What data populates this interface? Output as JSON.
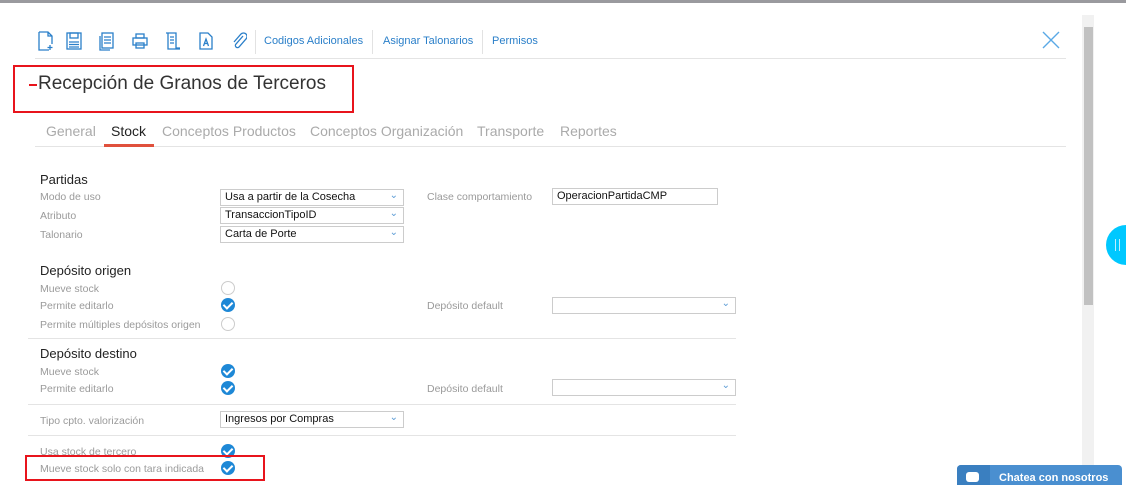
{
  "toolbar": {
    "icons": [
      "new-document-icon",
      "save-icon",
      "copy-icon",
      "print-icon",
      "list-document-icon",
      "text-document-icon",
      "attachment-icon"
    ],
    "links": [
      "Codigos Adicionales",
      "Asignar Talonarios",
      "Permisos"
    ]
  },
  "title": "Recepción de Granos de Terceros",
  "tabs": [
    "General",
    "Stock",
    "Conceptos Productos",
    "Conceptos Organización",
    "Transporte",
    "Reportes"
  ],
  "active_tab": "Stock",
  "partidas": {
    "heading": "Partidas",
    "modo_label": "Modo de uso",
    "modo_value": "Usa a partir de la Cosecha",
    "atributo_label": "Atributo",
    "atributo_value": "TransaccionTipoID",
    "talonario_label": "Talonario",
    "talonario_value": "Carta de Porte",
    "clase_label": "Clase comportamiento",
    "clase_value": "OperacionPartidaCMP"
  },
  "origen": {
    "heading": "Depósito origen",
    "mueve_label": "Mueve stock",
    "mueve": false,
    "editar_label": "Permite editarlo",
    "editar": true,
    "multiples_label": "Permite múltiples depósitos origen",
    "multiples": false,
    "default_label": "Depósito default",
    "default_value": ""
  },
  "destino": {
    "heading": "Depósito destino",
    "mueve_label": "Mueve stock",
    "mueve": true,
    "editar_label": "Permite editarlo",
    "editar": true,
    "default_label": "Depósito default",
    "default_value": ""
  },
  "valorizacion": {
    "label": "Tipo cpto. valorización",
    "value": "Ingresos por Compras"
  },
  "extra": {
    "usa_tercero_label": "Usa stock de tercero",
    "usa_tercero": true,
    "tara_label": "Mueve stock solo con tara indicada",
    "tara": true
  },
  "chat": {
    "label": "Chatea con nosotros"
  },
  "colors": {
    "accent": "#1e88d6",
    "link": "#2a7fc9",
    "highlight": "#e8141c"
  }
}
